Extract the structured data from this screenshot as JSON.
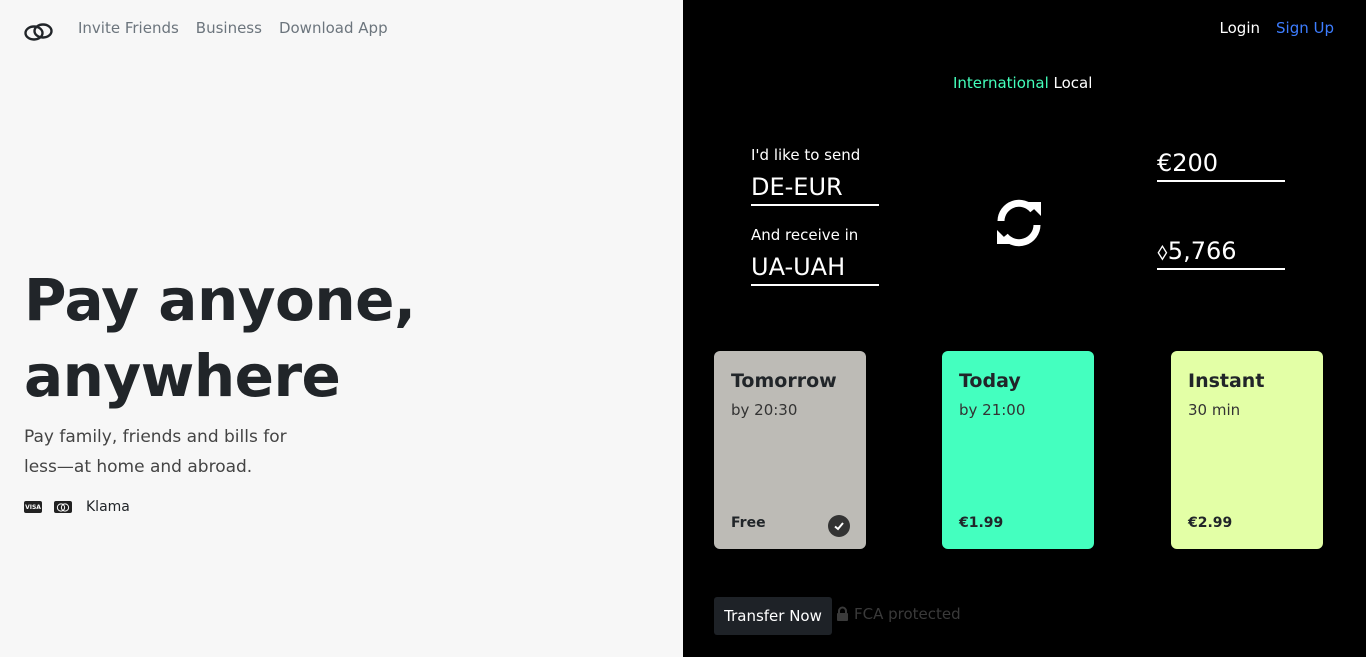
{
  "nav": {
    "links": [
      "Invite Friends",
      "Business",
      "Download App"
    ]
  },
  "hero": {
    "title_line1": "Pay anyone,",
    "title_line2": "anywhere",
    "subtitle": "Pay family, friends and bills for less—at home and abroad.",
    "payment_icons": [
      "visa-icon",
      "mastercard-icon"
    ],
    "payment_label": "Klama"
  },
  "auth": {
    "login": "Login",
    "signup": "Sign Up"
  },
  "mode": {
    "international": "International",
    "local": "Local"
  },
  "send": {
    "send_label": "I'd like to send",
    "send_currency": "DE-EUR",
    "receive_label": "And receive in",
    "receive_currency": "UA-UAH",
    "send_amount": "€200",
    "receive_amount": "⬨5,766"
  },
  "options": [
    {
      "title": "Tomorrow",
      "time": "by 20:30",
      "price": "Free",
      "color": "#bdbbb6",
      "selected": true
    },
    {
      "title": "Today",
      "time": "by 21:00",
      "price": "€1.99",
      "color": "#44ffbf",
      "selected": false
    },
    {
      "title": "Instant",
      "time": "30 min",
      "price": "€2.99",
      "color": "#e3ffa6",
      "selected": false
    }
  ],
  "cta": {
    "transfer": "Transfer Now",
    "fca": "FCA protected"
  },
  "colors": {
    "accent_green": "#44ffbb",
    "link_blue": "#3d7dff",
    "dark_panel": "#000000"
  }
}
